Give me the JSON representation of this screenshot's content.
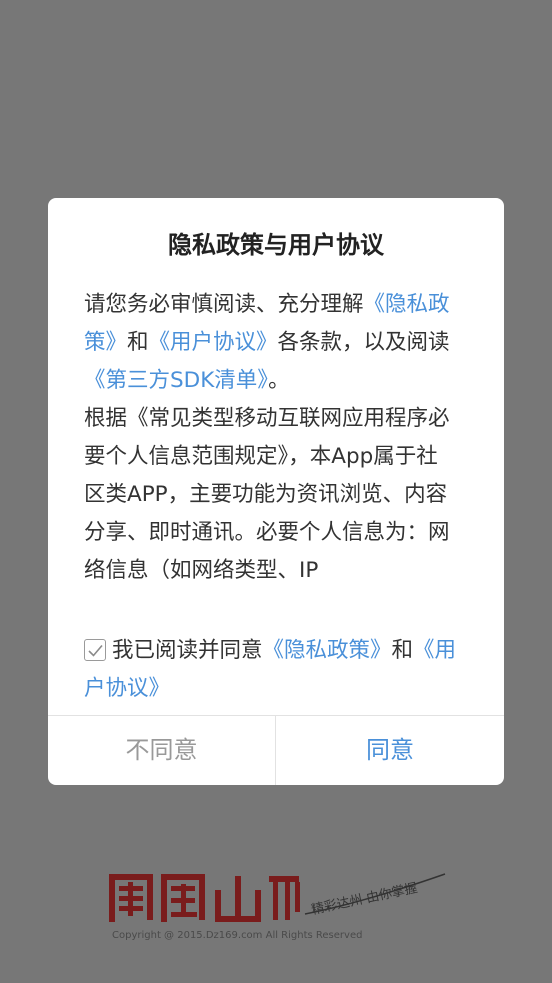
{
  "dialog": {
    "title": "隐私政策与用户协议",
    "paragraph1": {
      "t1": "请您务必审慎阅读、充分理解",
      "link_privacy": "《隐私政策》",
      "t2": "和",
      "link_user": "《用户协议》",
      "t3": "各条款，以及阅读",
      "link_sdk": "《第三方SDK清单》",
      "t4": "。"
    },
    "paragraph2": "根据《常见类型移动互联网应用程序必要个人信息范围规定》，本App属于社区类APP，主要功能为资讯浏览、内容分享、即时通讯。必要个人信息为：网络信息（如网络类型、IP",
    "agree_row": {
      "checked": true,
      "t1": "我已阅读并同意",
      "link_privacy": "《隐私政策》",
      "t2": "和",
      "link_user": "《用户协议》"
    },
    "buttons": {
      "disagree": "不同意",
      "agree": "同意"
    }
  },
  "footer": {
    "logo_text": "鳳凰山",
    "slogan": "精彩达州 由你掌握",
    "copyright": "Copyright @ 2015.Dz169.com All Rights Reserved"
  },
  "colors": {
    "overlay": "#777777",
    "link": "#4a90d9",
    "logo": "#7a1c1c"
  }
}
